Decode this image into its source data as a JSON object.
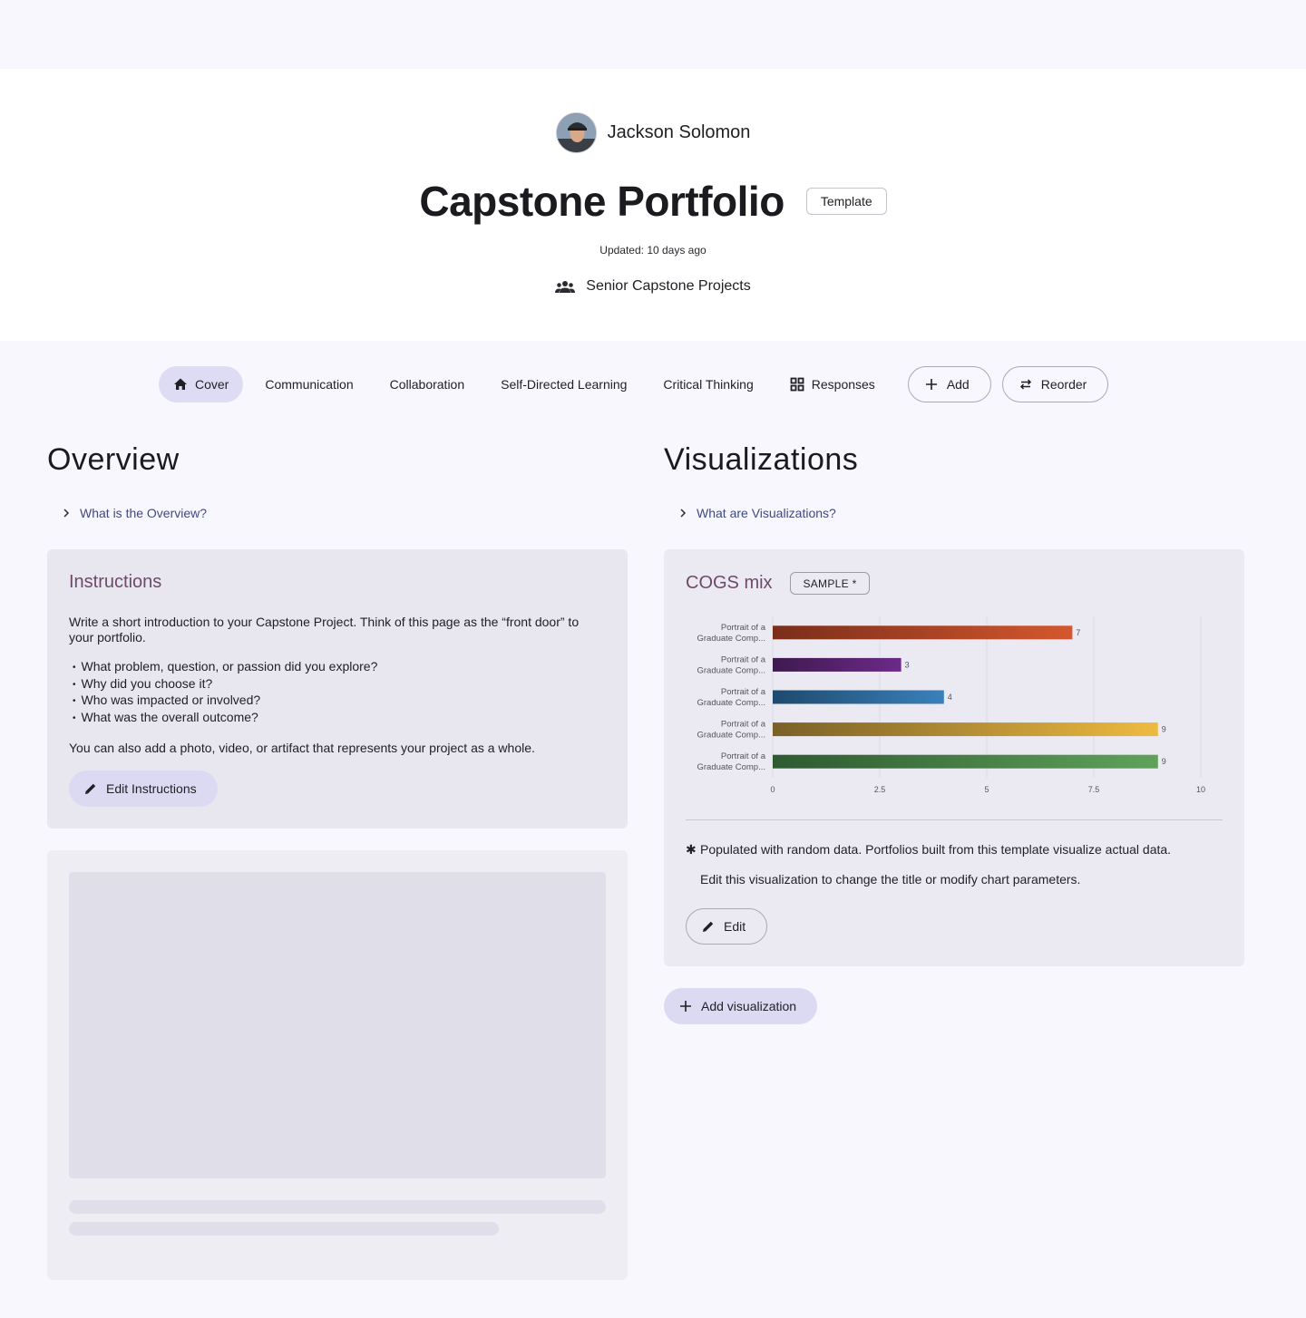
{
  "author": {
    "name": "Jackson Solomon",
    "avatar_icon": "user-photo-avatar"
  },
  "portfolio": {
    "title": "Capstone Portfolio",
    "badge": "Template",
    "updated": "Updated: 10 days ago",
    "group": "Senior Capstone Projects",
    "group_icon": "group-icon"
  },
  "tabs": [
    {
      "label": "Cover",
      "icon": "home-icon",
      "active": true
    },
    {
      "label": "Communication"
    },
    {
      "label": "Collaboration"
    },
    {
      "label": "Self-Directed Learning"
    },
    {
      "label": "Critical Thinking"
    },
    {
      "label": "Responses",
      "icon": "grid-icon"
    }
  ],
  "tab_actions": {
    "add_label": "Add",
    "reorder_label": "Reorder"
  },
  "overview": {
    "title": "Overview",
    "disclosure": "What is the Overview?",
    "instructions": {
      "title": "Instructions",
      "intro": "Write a short introduction to your Capstone Project. Think of this page as the “front door” to your portfolio.",
      "bullets": [
        "What problem, question, or passion did you explore?",
        "Why did you choose it?",
        "Who was impacted or involved?",
        "What was the overall outcome?"
      ],
      "outro": "You can also add a photo, video, or artifact that represents your project as a whole.",
      "edit_label": "Edit Instructions"
    }
  },
  "visualizations": {
    "title": "Visualizations",
    "disclosure": "What are Visualizations?",
    "card": {
      "title": "COGS mix",
      "badge": "SAMPLE *",
      "note_star": "✱",
      "note": "Populated with random data. Portfolios built from this template visualize actual data.",
      "note2": "Edit this visualization to change the title or modify chart parameters.",
      "edit_label": "Edit"
    },
    "add_label": "Add visualization"
  },
  "chart_data": {
    "type": "bar",
    "orientation": "horizontal",
    "categories": [
      [
        "Portrait of a",
        "Graduate Comp..."
      ],
      [
        "Portrait of a",
        "Graduate Comp..."
      ],
      [
        "Portrait of a",
        "Graduate Comp..."
      ],
      [
        "Portrait of a",
        "Graduate Comp..."
      ],
      [
        "Portrait of a",
        "Graduate Comp..."
      ]
    ],
    "values": [
      7,
      3,
      4,
      9,
      9
    ],
    "colors": [
      [
        "#7a2e1a",
        "#d4572e"
      ],
      [
        "#3e1a4e",
        "#6c2a8a"
      ],
      [
        "#1e4a6e",
        "#3a80bb"
      ],
      [
        "#7a6028",
        "#eebb40"
      ],
      [
        "#2e5a30",
        "#5ea35a"
      ]
    ],
    "xlim": [
      0,
      10
    ],
    "xticks": [
      "0",
      "2.5",
      "5",
      "7.5",
      "10"
    ],
    "grid": true
  }
}
